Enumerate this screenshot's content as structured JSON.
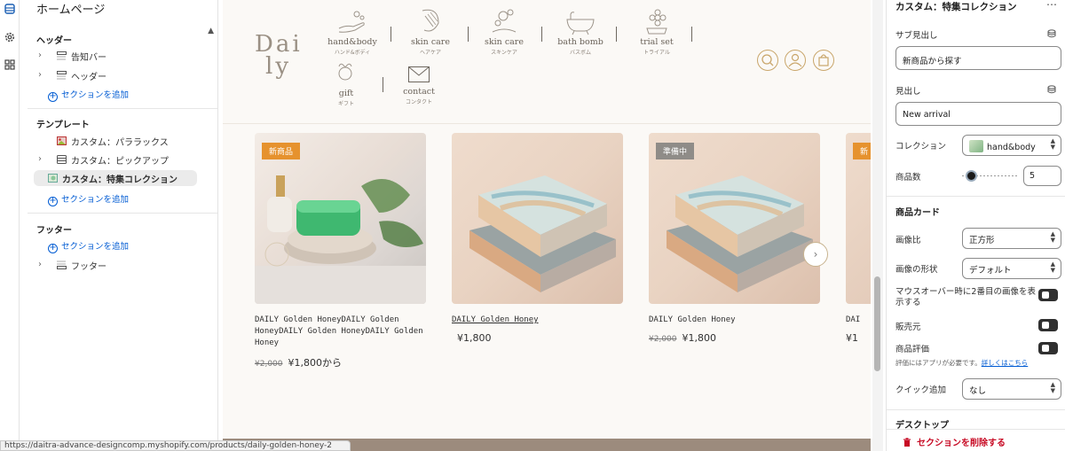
{
  "left_panel": {
    "title": "ホームページ",
    "groups": {
      "header": "ヘッダー",
      "template": "テンプレート",
      "footer": "フッター"
    },
    "items": {
      "announcement": "告知バー",
      "header": "ヘッダー",
      "parallax": "カスタム：パララックス",
      "pickup": "カスタム：ピックアップ",
      "featured": "カスタム：特集コレクション",
      "footer": "フッター"
    },
    "add_section": "セクションを追加"
  },
  "preview": {
    "logo_line1": "Dai",
    "logo_line2": "ly",
    "nav": [
      {
        "en": "hand&body",
        "jp": "ハンド&ボディ"
      },
      {
        "en": "skin care",
        "jp": "ヘアケア"
      },
      {
        "en": "skin care",
        "jp": "スキンケア"
      },
      {
        "en": "bath bomb",
        "jp": "バスボム"
      },
      {
        "en": "trial set",
        "jp": "トライアル"
      },
      {
        "en": "gift",
        "jp": "ギフト"
      },
      {
        "en": "contact",
        "jp": "コンタクト"
      }
    ],
    "products": [
      {
        "badge": "新商品",
        "badge_color": "#e6922e",
        "name": "DAILY Golden HoneyDAILY Golden HoneyDAILY Golden HoneyDAILY Golden Honey",
        "old_price": "¥2,000",
        "price": "¥1,800から"
      },
      {
        "badge": "",
        "name": "DAILY Golden Honey",
        "old_price": "",
        "price": "¥1,800"
      },
      {
        "badge": "準備中",
        "badge_color": "#8f8c88",
        "name": "DAILY Golden Honey",
        "old_price": "¥2,000",
        "price": "¥1,800"
      },
      {
        "badge": "新",
        "badge_color": "#e6922e",
        "name": "DAI",
        "old_price": "",
        "price": "¥1"
      }
    ]
  },
  "right_panel": {
    "title": "カスタム：特集コレクション",
    "subheading_label": "サブ見出し",
    "subheading_value": "新商品から探す",
    "heading_label": "見出し",
    "heading_value": "New arrival",
    "collection_label": "コレクション",
    "collection_value": "hand&body",
    "count_label": "商品数",
    "count_value": "5",
    "count_fraction": 0.0,
    "card_section": "商品カード",
    "ratio_label": "画像比",
    "ratio_value": "正方形",
    "shape_label": "画像の形状",
    "shape_value": "デフォルト",
    "hover_label": "マウスオーバー時に2番目の画像を表示する",
    "vendor_label": "販売元",
    "rating_label": "商品評価",
    "rating_note": "評価にはアプリが必要です。",
    "rating_link": "詳しくはこちら",
    "quick_label": "クイック追加",
    "quick_value": "なし",
    "desktop_section": "デスクトップ",
    "delete_label": "セクションを削除する"
  },
  "status_url": "https://daitra-advance-designcomp.myshopify.com/products/daily-golden-honey-2"
}
